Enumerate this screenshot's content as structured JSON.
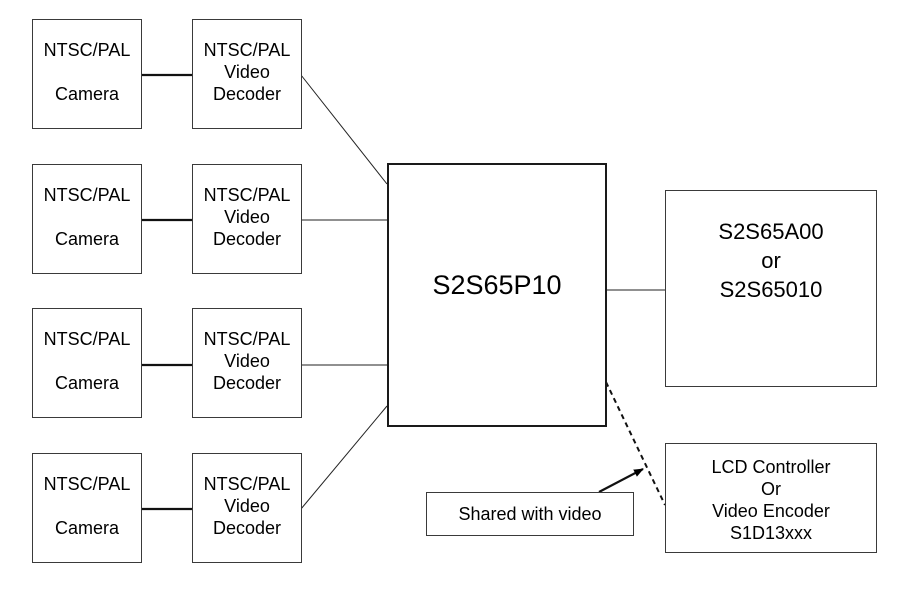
{
  "diagram": {
    "channels": [
      {
        "camera": {
          "line1": "NTSC/PAL",
          "line2": "Camera"
        },
        "decoder": {
          "line1": "NTSC/PAL",
          "line2": "Video",
          "line3": "Decoder"
        }
      },
      {
        "camera": {
          "line1": "NTSC/PAL",
          "line2": "Camera"
        },
        "decoder": {
          "line1": "NTSC/PAL",
          "line2": "Video",
          "line3": "Decoder"
        }
      },
      {
        "camera": {
          "line1": "NTSC/PAL",
          "line2": "Camera"
        },
        "decoder": {
          "line1": "NTSC/PAL",
          "line2": "Video",
          "line3": "Decoder"
        }
      },
      {
        "camera": {
          "line1": "NTSC/PAL",
          "line2": "Camera"
        },
        "decoder": {
          "line1": "NTSC/PAL",
          "line2": "Video",
          "line3": "Decoder"
        }
      }
    ],
    "main_chip": "S2S65P10",
    "external_chip": {
      "line1": "S2S65A00",
      "line2": "or",
      "line3": "S2S65010"
    },
    "lcd_block": {
      "line1": "LCD Controller",
      "line2": "Or",
      "line3": "Video Encoder",
      "line4": "S1D13xxx"
    },
    "note": "Shared with video",
    "connections": [
      {
        "from": "camera-1",
        "to": "decoder-1",
        "style": "solid"
      },
      {
        "from": "camera-2",
        "to": "decoder-2",
        "style": "solid"
      },
      {
        "from": "camera-3",
        "to": "decoder-3",
        "style": "solid"
      },
      {
        "from": "camera-4",
        "to": "decoder-4",
        "style": "solid"
      },
      {
        "from": "decoder-1",
        "to": "S2S65P10",
        "style": "solid"
      },
      {
        "from": "decoder-2",
        "to": "S2S65P10",
        "style": "solid"
      },
      {
        "from": "decoder-3",
        "to": "S2S65P10",
        "style": "solid"
      },
      {
        "from": "decoder-4",
        "to": "S2S65P10",
        "style": "solid"
      },
      {
        "from": "S2S65P10",
        "to": "external-chip",
        "style": "solid"
      },
      {
        "from": "S2S65P10",
        "to": "lcd-block",
        "style": "dashed"
      },
      {
        "from": "note",
        "to": "dashed-link",
        "style": "arrow"
      }
    ]
  }
}
